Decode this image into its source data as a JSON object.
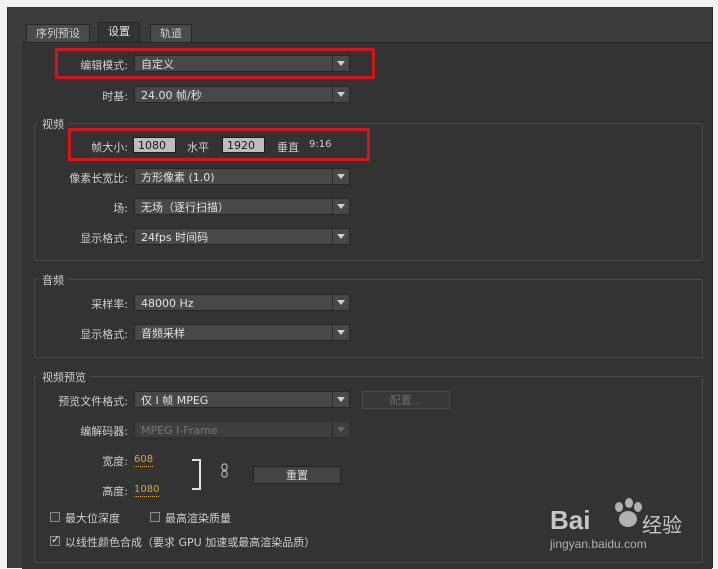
{
  "tabs": [
    {
      "label": "序列预设",
      "active": false
    },
    {
      "label": "设置",
      "active": true
    },
    {
      "label": "轨道",
      "active": false
    }
  ],
  "top": {
    "edit_mode": {
      "label": "编辑模式:",
      "value": "自定义"
    },
    "timebase": {
      "label": "时基:",
      "value": "24.00 帧/秒"
    }
  },
  "video": {
    "title": "视频",
    "frame_size": {
      "label": "帧大小:",
      "width": "1080",
      "horizontal_label": "水平",
      "height": "1920",
      "vertical_label": "垂直",
      "ratio": "9:16"
    },
    "pixel_aspect": {
      "label": "像素长宽比:",
      "value": "方形像素 (1.0)"
    },
    "fields": {
      "label": "场:",
      "value": "无场（逐行扫描）"
    },
    "display_format": {
      "label": "显示格式:",
      "value": "24fps 时间码"
    }
  },
  "audio": {
    "title": "音频",
    "sample_rate": {
      "label": "采样率:",
      "value": "48000 Hz"
    },
    "display_format": {
      "label": "显示格式:",
      "value": "音频采样"
    }
  },
  "video_preview": {
    "title": "视频预览",
    "preview_format": {
      "label": "预览文件格式:",
      "value": "仅 I 帧 MPEG"
    },
    "configure_label": "配置...",
    "codec": {
      "label": "编解码器:",
      "value": "MPEG I-Frame"
    },
    "width": {
      "label": "宽度:",
      "value": "608"
    },
    "height": {
      "label": "高度:",
      "value": "1080"
    },
    "reset_label": "重置",
    "max_bit_depth": "最大位深度",
    "max_render_quality": "最高渲染质量",
    "linear_color": "以线性颜色合成（要求 GPU 加速或最高渲染品质）"
  },
  "watermark": {
    "brand": "Bai",
    "suffix": "经验",
    "url": "jingyan.baidu.com"
  },
  "colors": {
    "highlight": "#d4161c",
    "link": "#e0a33c",
    "panel_bg": "#333333"
  }
}
